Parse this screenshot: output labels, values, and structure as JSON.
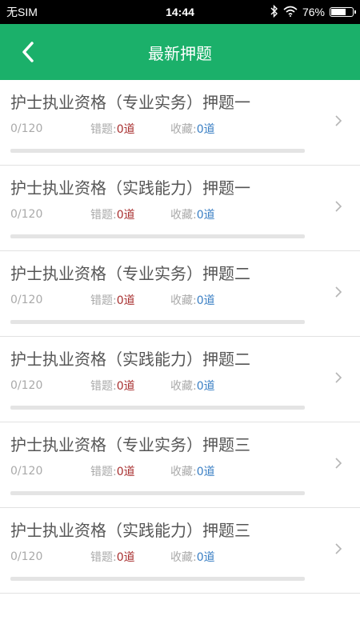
{
  "status_bar": {
    "carrier": "无SIM",
    "time": "14:44",
    "battery_percent_text": "76%",
    "battery_level": 0.76
  },
  "nav": {
    "title": "最新押题",
    "back_icon": "chevron-left-icon"
  },
  "labels": {
    "wrong": "错题:",
    "favorites": "收藏:"
  },
  "items": [
    {
      "title": "护士执业资格（专业实务）押题一",
      "progress": "0/120",
      "progress_fraction": 0,
      "wrong": "0道",
      "favorites": "0道"
    },
    {
      "title": "护士执业资格（实践能力）押题一",
      "progress": "0/120",
      "progress_fraction": 0,
      "wrong": "0道",
      "favorites": "0道"
    },
    {
      "title": "护士执业资格（专业实务）押题二",
      "progress": "0/120",
      "progress_fraction": 0,
      "wrong": "0道",
      "favorites": "0道"
    },
    {
      "title": "护士执业资格（实践能力）押题二",
      "progress": "0/120",
      "progress_fraction": 0,
      "wrong": "0道",
      "favorites": "0道"
    },
    {
      "title": "护士执业资格（专业实务）押题三",
      "progress": "0/120",
      "progress_fraction": 0,
      "wrong": "0道",
      "favorites": "0道"
    },
    {
      "title": "护士执业资格（实践能力）押题三",
      "progress": "0/120",
      "progress_fraction": 0,
      "wrong": "0道",
      "favorites": "0道"
    }
  ],
  "colors": {
    "accent": "#1bb06a",
    "wrong_value": "#a83030",
    "favorite_value": "#3a7fc4"
  }
}
